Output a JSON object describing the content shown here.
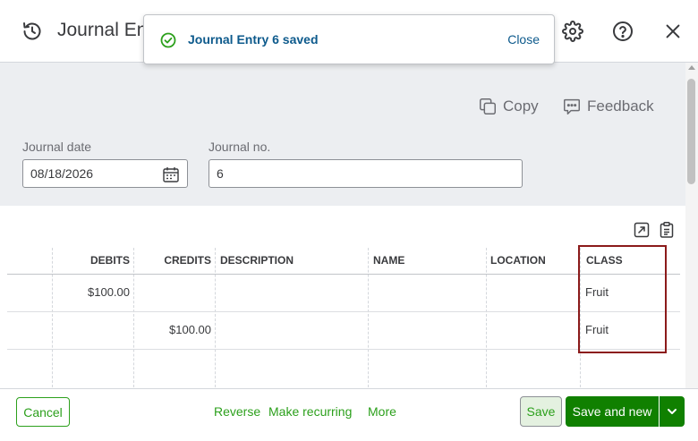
{
  "header": {
    "title": "Journal Entry",
    "history_icon": "history-icon",
    "settings_icon": "gear-icon",
    "help_icon": "help-icon",
    "close_icon": "close-icon"
  },
  "toast": {
    "message": "Journal Entry 6 saved",
    "close_label": "Close",
    "icon": "check-circle-icon"
  },
  "actions": {
    "copy_label": "Copy",
    "feedback_label": "Feedback"
  },
  "form": {
    "journal_date_label": "Journal date",
    "journal_date_value": "08/18/2026",
    "journal_no_label": "Journal no.",
    "journal_no_value": "6"
  },
  "table": {
    "columns": [
      "DEBITS",
      "CREDITS",
      "DESCRIPTION",
      "NAME",
      "LOCATION",
      "CLASS"
    ],
    "rows": [
      {
        "debits": "$100.00",
        "credits": "",
        "description": "",
        "name": "",
        "location": "",
        "class": "Fruit"
      },
      {
        "debits": "",
        "credits": "$100.00",
        "description": "",
        "name": "",
        "location": "",
        "class": "Fruit"
      }
    ]
  },
  "footer": {
    "cancel_label": "Cancel",
    "reverse_label": "Reverse",
    "make_recurring_label": "Make recurring",
    "more_label": "More",
    "save_label": "Save",
    "save_new_label": "Save and new"
  },
  "colors": {
    "brand_green": "#2ca01c",
    "primary_green": "#108000",
    "link_blue": "#0d5a8c",
    "highlight_red": "#8b1a1a"
  }
}
